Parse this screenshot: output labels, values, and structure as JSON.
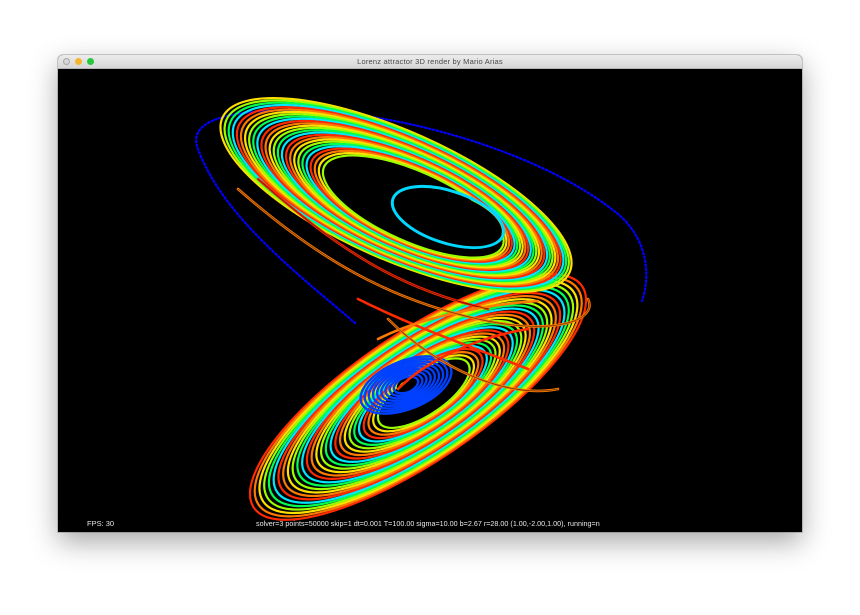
{
  "window": {
    "title": "Lorenz attractor 3D render by Mario Arias",
    "controls": [
      "close-button",
      "minimize-button",
      "zoom-button"
    ]
  },
  "hud": {
    "fps": "FPS: 30",
    "status": "solver=3 points=50000  skip=1  dt=0.001  T=100.00  sigma=10.00  b=2.67  r=28.00  (1.00,-2.00,1.00), running=n"
  },
  "render": {
    "background": "#000000",
    "palette": [
      "#ff2a00",
      "#ff7a00",
      "#ffe000",
      "#9cff00",
      "#00ff50",
      "#00e8ff",
      "#0050ff",
      "#ffffff",
      "#ff0000"
    ],
    "transient_color": "#0000ff"
  }
}
